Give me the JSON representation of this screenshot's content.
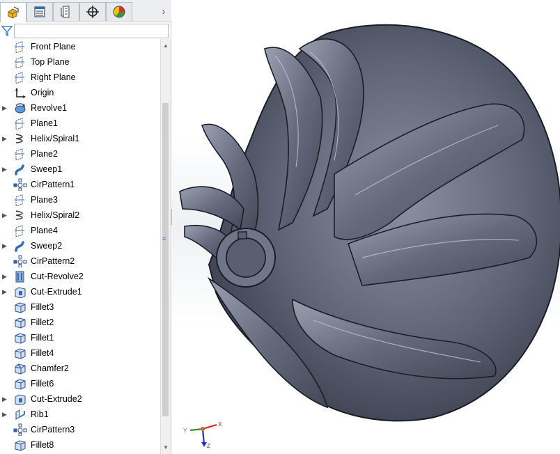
{
  "panel": {
    "tabs": [
      {
        "name": "FeatureManager design tree",
        "icon": "feature-manager-icon",
        "active": true
      },
      {
        "name": "PropertyManager",
        "icon": "property-manager-icon",
        "active": false
      },
      {
        "name": "ConfigurationManager",
        "icon": "configuration-manager-icon",
        "active": false
      },
      {
        "name": "DimXpertManager",
        "icon": "dimxpert-icon",
        "active": false
      },
      {
        "name": "DisplayManager",
        "icon": "display-manager-icon",
        "active": false
      }
    ],
    "filter": {
      "placeholder": "",
      "value": ""
    },
    "tree": [
      {
        "label": "Front Plane",
        "icon": "plane-icon",
        "expandable": false
      },
      {
        "label": "Top Plane",
        "icon": "plane-icon",
        "expandable": false
      },
      {
        "label": "Right Plane",
        "icon": "plane-icon",
        "expandable": false
      },
      {
        "label": "Origin",
        "icon": "origin-icon",
        "expandable": false
      },
      {
        "label": "Revolve1",
        "icon": "revolve-icon",
        "expandable": true
      },
      {
        "label": "Plane1",
        "icon": "plane-icon",
        "expandable": false
      },
      {
        "label": "Helix/Spiral1",
        "icon": "helix-icon",
        "expandable": true
      },
      {
        "label": "Plane2",
        "icon": "plane-icon",
        "expandable": false
      },
      {
        "label": "Sweep1",
        "icon": "sweep-icon",
        "expandable": true
      },
      {
        "label": "CirPattern1",
        "icon": "circular-pattern-icon",
        "expandable": false
      },
      {
        "label": "Plane3",
        "icon": "plane-icon",
        "expandable": false
      },
      {
        "label": "Helix/Spiral2",
        "icon": "helix-icon",
        "expandable": true
      },
      {
        "label": "Plane4",
        "icon": "plane-icon",
        "expandable": false
      },
      {
        "label": "Sweep2",
        "icon": "sweep-icon",
        "expandable": true
      },
      {
        "label": "CirPattern2",
        "icon": "circular-pattern-icon",
        "expandable": false
      },
      {
        "label": "Cut-Revolve2",
        "icon": "cut-revolve-icon",
        "expandable": true
      },
      {
        "label": "Cut-Extrude1",
        "icon": "cut-extrude-icon",
        "expandable": true
      },
      {
        "label": "Fillet3",
        "icon": "fillet-icon",
        "expandable": false
      },
      {
        "label": "Fillet2",
        "icon": "fillet-icon",
        "expandable": false
      },
      {
        "label": "Fillet1",
        "icon": "fillet-icon",
        "expandable": false
      },
      {
        "label": "Fillet4",
        "icon": "fillet-icon",
        "expandable": false
      },
      {
        "label": "Chamfer2",
        "icon": "chamfer-icon",
        "expandable": false
      },
      {
        "label": "Fillet6",
        "icon": "fillet-icon",
        "expandable": false
      },
      {
        "label": "Cut-Extrude2",
        "icon": "cut-extrude-icon",
        "expandable": true
      },
      {
        "label": "Rib1",
        "icon": "rib-icon",
        "expandable": true
      },
      {
        "label": "CirPattern3",
        "icon": "circular-pattern-icon",
        "expandable": false
      },
      {
        "label": "Fillet8",
        "icon": "fillet-icon",
        "expandable": false
      }
    ]
  },
  "viewport": {
    "model": "impeller-model",
    "triad": {
      "x": "X",
      "y": "Y",
      "z": "Z"
    }
  },
  "colors": {
    "model_face": "#5f6577",
    "model_edge": "#1b1d26",
    "icon_blue": "#2f6db5",
    "axis_x": "#d62020",
    "axis_y": "#2a9a2a",
    "axis_z": "#2233cc"
  }
}
